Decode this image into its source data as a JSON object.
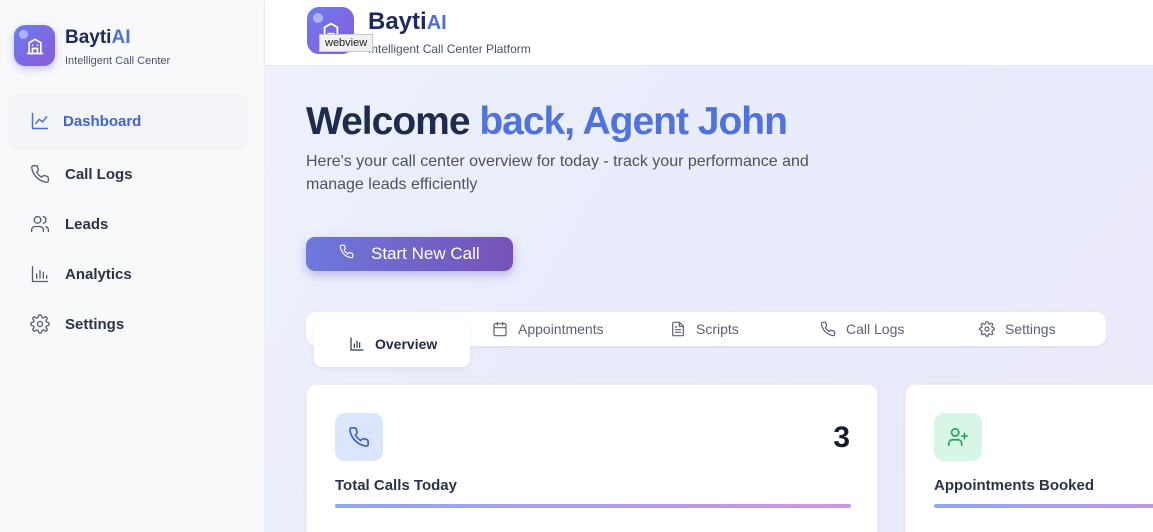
{
  "sidebar": {
    "brand_name": "Bayti",
    "brand_ai": "AI",
    "brand_sub": "Intelligent Call Center",
    "items": [
      {
        "label": "Dashboard",
        "icon": "chart-line-icon",
        "active": true
      },
      {
        "label": "Call Logs",
        "icon": "phone-icon"
      },
      {
        "label": "Leads",
        "icon": "users-icon"
      },
      {
        "label": "Analytics",
        "icon": "bar-chart-icon"
      },
      {
        "label": "Settings",
        "icon": "gear-icon"
      }
    ]
  },
  "header": {
    "name": "Bayti",
    "ai": "AI",
    "sub": "Intelligent Call Center Platform",
    "tooltip": "webview"
  },
  "main": {
    "welcome_part1": "Welcome",
    "welcome_part2": "back, Agent John",
    "subtitle": "Here's your call center overview for today - track your performance and manage leads efficiently",
    "start_button": "Start New Call",
    "tabs": [
      {
        "label": "Overview",
        "icon": "bar-chart-icon",
        "active": true
      },
      {
        "label": "Appointments",
        "icon": "calendar-icon"
      },
      {
        "label": "Scripts",
        "icon": "document-icon"
      },
      {
        "label": "Call Logs",
        "icon": "phone-icon"
      },
      {
        "label": "Settings",
        "icon": "gear-icon"
      }
    ],
    "cards": [
      {
        "title": "Total Calls Today",
        "value": "3",
        "icon": "phone-icon",
        "icon_bg": "#dbe6fd",
        "icon_color": "#3b5fd0"
      },
      {
        "title": "Appointments Booked",
        "value": "",
        "icon": "user-plus-icon",
        "icon_bg": "#d8f6e6",
        "icon_color": "#21a363"
      }
    ]
  },
  "colors": {
    "accent": "#4f6fd8",
    "brand_gradient_start": "#6a7cf0",
    "brand_gradient_end": "#8b5ad8"
  }
}
